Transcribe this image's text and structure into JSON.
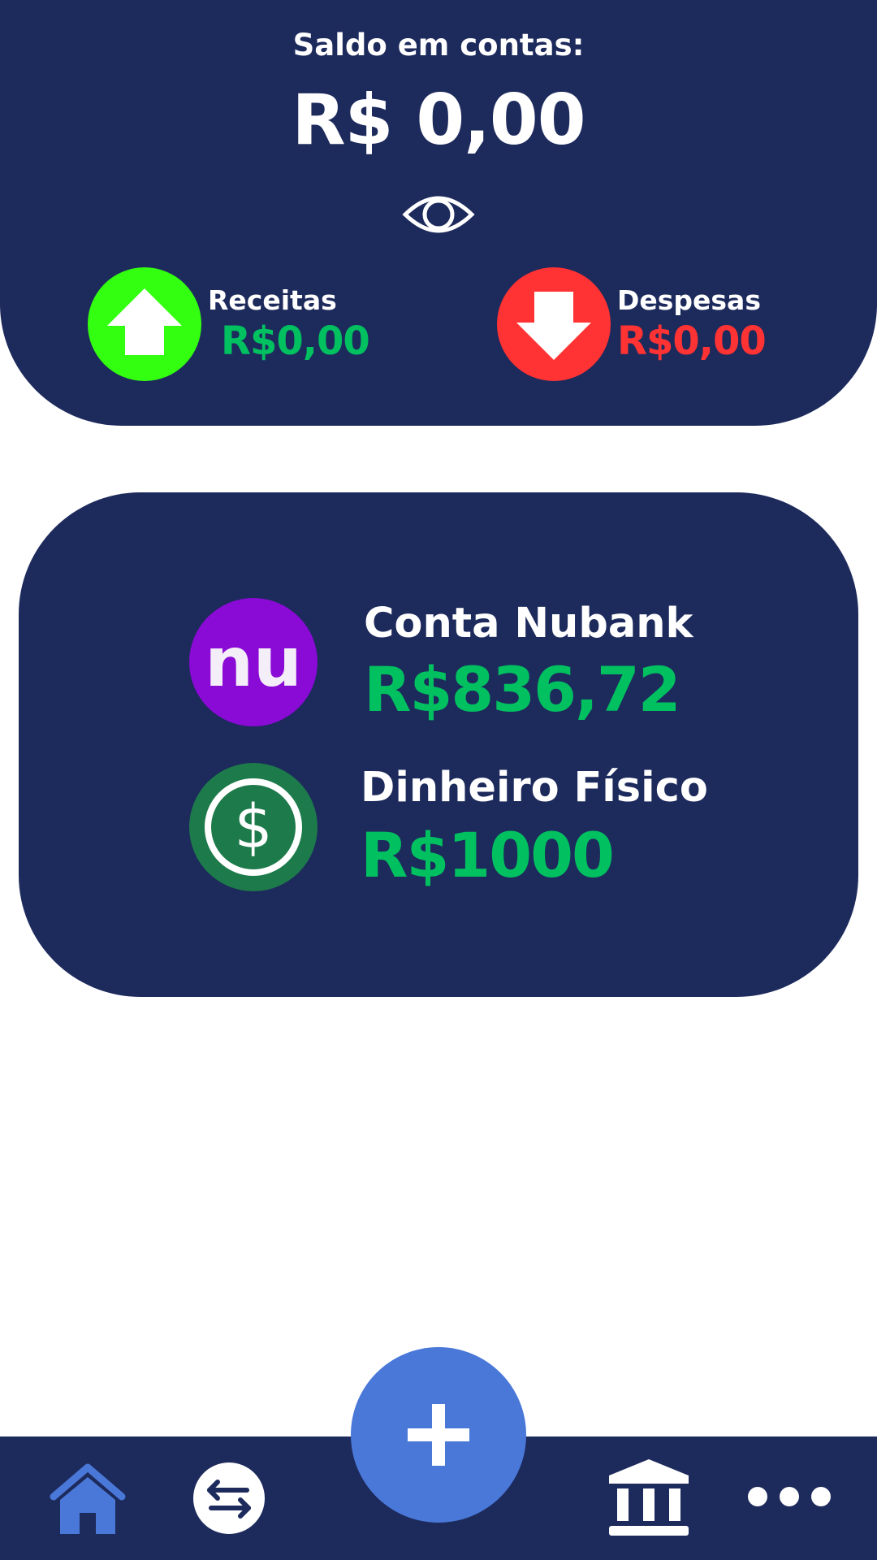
{
  "header": {
    "balance_label": "Saldo em contas:",
    "balance_value": "R$ 0,00",
    "visibility_icon": "eye-icon",
    "income": {
      "label": "Receitas",
      "value": "R$0,00",
      "color": "#00c060",
      "icon": "arrow-up-icon",
      "icon_bg": "#33ff11"
    },
    "expense": {
      "label": "Despesas",
      "value": "R$0,00",
      "color": "#ff3333",
      "icon": "arrow-down-icon",
      "icon_bg": "#ff3333"
    }
  },
  "accounts": [
    {
      "name": "Conta Nubank",
      "balance": "R$836,72",
      "icon": "nubank-logo",
      "icon_text": "nu",
      "icon_bg": "#8a0ad6"
    },
    {
      "name": "Dinheiro Físico",
      "balance": "R$1000",
      "icon": "dollar-icon",
      "icon_bg": "#1d7a4a"
    }
  ],
  "bottom_nav": {
    "items": [
      "home-icon",
      "transfer-icon",
      "bank-icon",
      "more-icon"
    ],
    "fab_icon": "plus-icon",
    "active_color": "#4a78d8"
  },
  "colors": {
    "primary": "#1d2a5c",
    "accent": "#4a78d8",
    "positive": "#00c060",
    "negative": "#ff3333"
  }
}
